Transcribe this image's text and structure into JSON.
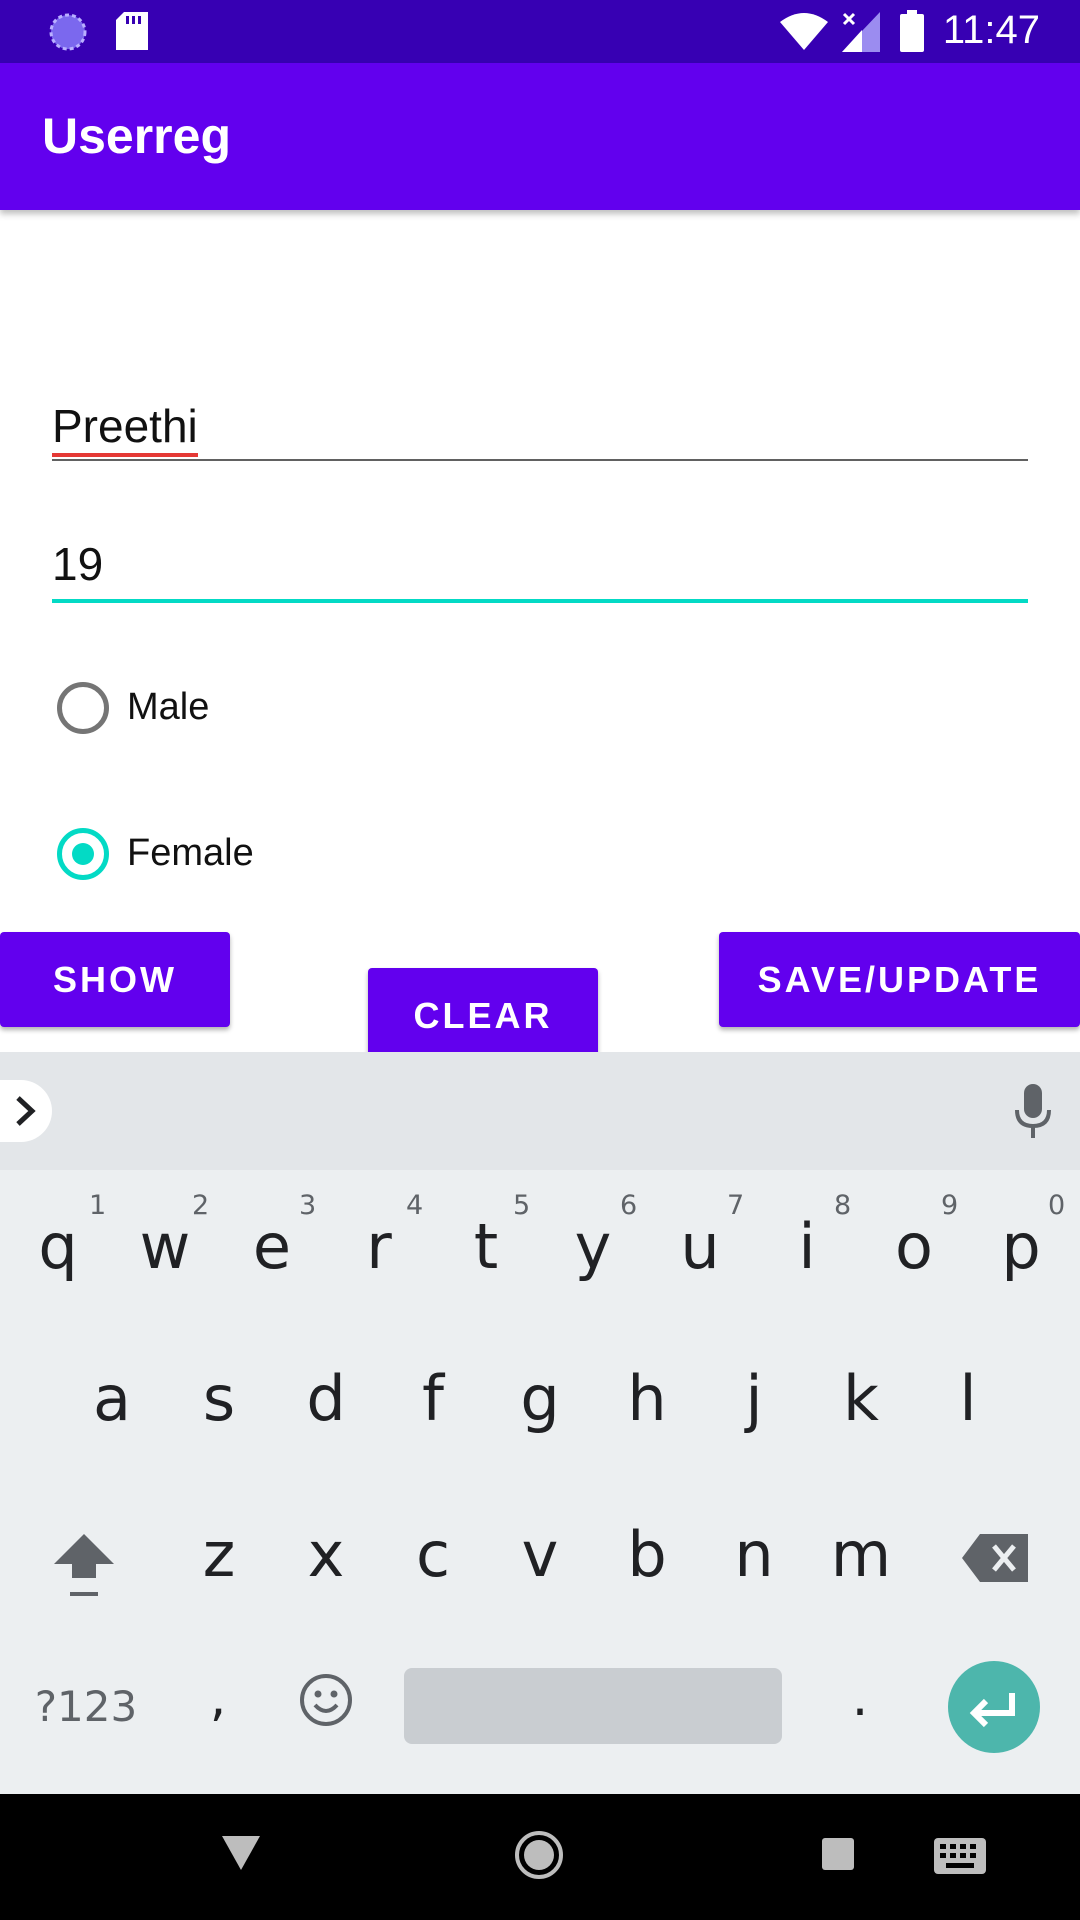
{
  "status_bar": {
    "time": "11:47",
    "icons": [
      "sync-icon",
      "sd-card-icon",
      "wifi-icon",
      "cell-signal-icon",
      "battery-icon"
    ]
  },
  "app_bar": {
    "title": "Userreg"
  },
  "form": {
    "name_value": "Preethi",
    "age_value": "19",
    "gender_options": [
      {
        "label": "Male",
        "checked": false
      },
      {
        "label": "Female",
        "checked": true
      }
    ]
  },
  "buttons": {
    "show": "SHOW",
    "clear": "CLEAR",
    "save_update": "SAVE/UPDATE"
  },
  "keyboard": {
    "row1": [
      "q",
      "w",
      "e",
      "r",
      "t",
      "y",
      "u",
      "i",
      "o",
      "p"
    ],
    "row1_hints": [
      "1",
      "2",
      "3",
      "4",
      "5",
      "6",
      "7",
      "8",
      "9",
      "0"
    ],
    "row2": [
      "a",
      "s",
      "d",
      "f",
      "g",
      "h",
      "j",
      "k",
      "l"
    ],
    "row3": [
      "z",
      "x",
      "c",
      "v",
      "b",
      "n",
      "m"
    ],
    "symbols_key": "?123",
    "comma_key": ",",
    "period_key": "."
  },
  "colors": {
    "status_bar": "#3700b3",
    "primary": "#6200ee",
    "accent": "#03dac5"
  }
}
